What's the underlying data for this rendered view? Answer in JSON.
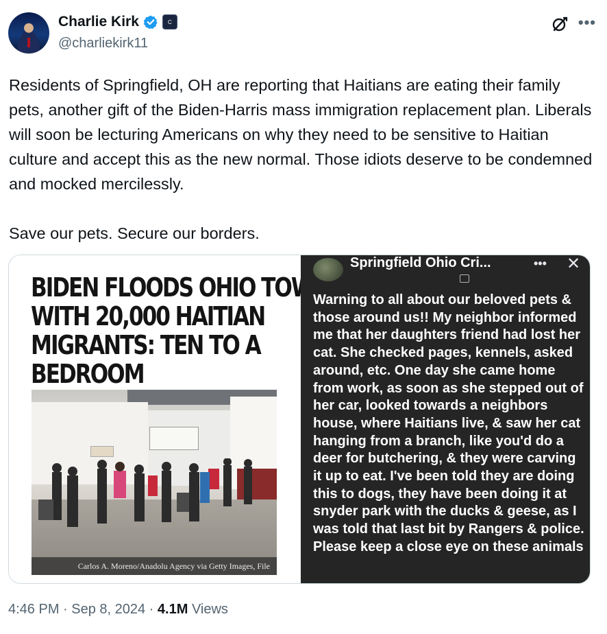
{
  "author": {
    "name": "Charlie Kirk",
    "handle": "@charliekirk11",
    "verified": true,
    "avatar_icon": "profile-photo",
    "org_badge_text": "C"
  },
  "header_actions": {
    "grok_icon": "grok-icon",
    "more_icon": "more-icon",
    "more_glyph": "•••"
  },
  "tweet": {
    "paragraph1": "Residents of Springfield, OH are reporting that Haitians are eating their family pets, another gift of the Biden-Harris mass immigration replacement plan. Liberals will soon be lecturing Americans on why they need to be sensitive to Haitian culture and accept this as the new normal. Those idiots deserve to be condemned and mocked mercilessly.",
    "paragraph2": "Save our pets. Secure our borders."
  },
  "media": {
    "left_image": {
      "headline_line1": "BIDEN FLOODS OHIO TOWN",
      "headline_line2": "WITH 20,000 HAITIAN",
      "headline_line3": "MIGRANTS: TEN TO A",
      "headline_line4": "BEDROOM",
      "photo_caption": "Carlos A. Moreno/Anadolu Agency via Getty Images, File"
    },
    "right_image": {
      "group_title": "Springfield Ohio Cri...",
      "more_glyph": "•••",
      "close_glyph": "✕",
      "post_text": "Warning to all about our beloved pets & those around us!! My neighbor informed me that her daughters friend had lost her cat. She checked pages, kennels, asked around, etc. One day she came home from work, as soon as she stepped out of her car, looked towards a neighbors house, where Haitians live, & saw her cat hanging from a branch, like you'd do a deer for butchering, & they were carving it up to eat. I've been told they are doing this to dogs, they have been doing it at snyder park with the ducks & geese, as I was told that last bit by Rangers & police. Please keep a close eye on these animals"
    }
  },
  "meta": {
    "time": "4:46 PM",
    "separator": " · ",
    "date": "Sep 8, 2024",
    "views_count": "4.1M",
    "views_label": " Views"
  },
  "colors": {
    "text_primary": "#0f1419",
    "text_secondary": "#536471",
    "verified_blue": "#1d9bf0",
    "border": "#cfd9de",
    "fb_dark": "#252525"
  }
}
